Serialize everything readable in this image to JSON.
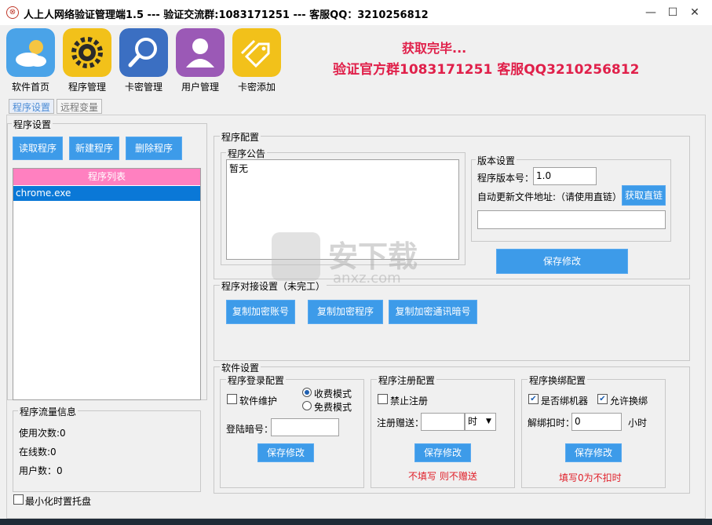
{
  "window": {
    "title": "人上人网络验证管理端1.5 --- 验证交流群:1083171251 --- 客服QQ：3210256812",
    "minimize": "—",
    "maximize": "☐",
    "close": "✕",
    "app_icon": "⊗"
  },
  "toolbar": {
    "items": [
      {
        "label": "软件首页",
        "icon": "cloud-sun-icon",
        "color": "#4aa3e8"
      },
      {
        "label": "程序管理",
        "icon": "gear-icon",
        "color": "#f2c11a"
      },
      {
        "label": "卡密管理",
        "icon": "search-icon",
        "color": "#3b6fc2"
      },
      {
        "label": "用户管理",
        "icon": "user-icon",
        "color": "#9b59b6"
      },
      {
        "label": "卡密添加",
        "icon": "tag-icon",
        "color": "#f2c11a"
      }
    ]
  },
  "status": {
    "line1": "获取完毕...",
    "line2": "验证官方群1083171251 客服QQ3210256812",
    "color": "#e0204a"
  },
  "tabs": [
    {
      "label": "程序设置",
      "active": true
    },
    {
      "label": "远程变量",
      "active": false
    }
  ],
  "program_settings": {
    "group_title": "程序设置",
    "read_button": "读取程序",
    "new_button": "新建程序",
    "delete_button": "删除程序",
    "list_header": "程序列表",
    "list_items": [
      "chrome.exe"
    ],
    "selected_index": 0
  },
  "traffic": {
    "group_title": "程序流量信息",
    "use_count": "使用次数:0",
    "online_count": "在线数:0",
    "user_count": "用户数：0"
  },
  "minimize_tray": {
    "label": "最小化时置托盘",
    "checked": false
  },
  "program_config": {
    "group_title": "程序配置",
    "announcement": {
      "group_title": "程序公告",
      "value": "暂无"
    },
    "version": {
      "group_title": "版本设置",
      "version_label": "程序版本号：",
      "version_value": "1.0",
      "update_label": "自动更新文件地址:（请使用直链）",
      "get_link_button": "获取直链",
      "update_url": ""
    },
    "save_button": "保存修改"
  },
  "connect": {
    "group_title": "程序对接设置（未完工）",
    "copy_account_button": "复制加密账号",
    "copy_program_button": "复制加密程序",
    "copy_code_button": "复制加密通讯暗号"
  },
  "software": {
    "group_title": "软件设置",
    "login": {
      "group_title": "程序登录配置",
      "maintenance_label": "软件维护",
      "maintenance_checked": false,
      "paid_label": "收费模式",
      "free_label": "免费模式",
      "mode": "paid",
      "code_label": "登陆暗号：",
      "code_value": "",
      "save_button": "保存修改"
    },
    "register": {
      "group_title": "程序注册配置",
      "disable_label": "禁止注册",
      "disable_checked": false,
      "gift_label": "注册赠送：",
      "gift_value": "",
      "unit_value": "时",
      "save_button": "保存修改",
      "note": "不填写 则不赠送"
    },
    "rebind": {
      "group_title": "程序换绑配置",
      "bind_label": "是否绑机器",
      "bind_checked": true,
      "allow_label": "允许换绑",
      "allow_checked": true,
      "deduct_label": "解绑扣时：",
      "deduct_value": "0",
      "unit_label": "小时",
      "save_button": "保存修改",
      "note": "填写0为不扣时"
    }
  },
  "watermark": {
    "text": "安下载",
    "sub": "anxz.com"
  }
}
